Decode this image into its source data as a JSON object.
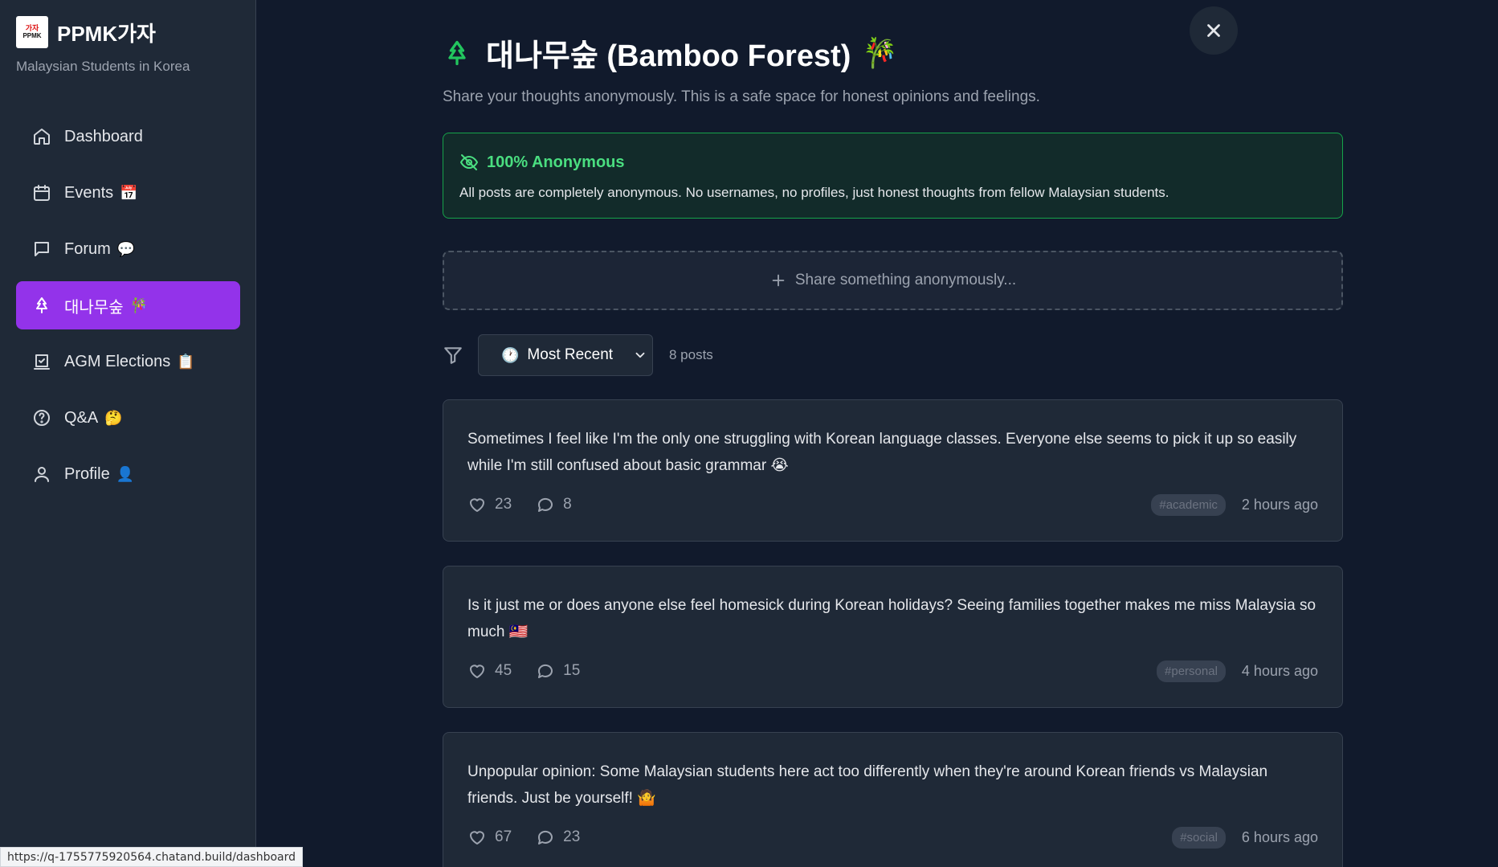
{
  "brand": {
    "name": "PPMK가자",
    "subtitle": "Malaysian Students in Korea",
    "logo_top": "가자",
    "logo_bottom": "PPMK"
  },
  "nav": {
    "items": [
      {
        "label": "Dashboard",
        "emoji": "",
        "icon": "home-icon",
        "active": false
      },
      {
        "label": "Events",
        "emoji": "📅",
        "icon": "calendar-icon",
        "active": false
      },
      {
        "label": "Forum",
        "emoji": "💬",
        "icon": "message-square-icon",
        "active": false
      },
      {
        "label": "대나무숲",
        "emoji": "🎋",
        "icon": "tree-icon",
        "active": true
      },
      {
        "label": "AGM Elections",
        "emoji": "📋",
        "icon": "vote-icon",
        "active": false
      },
      {
        "label": "Q&A",
        "emoji": "🤔",
        "icon": "help-circle-icon",
        "active": false
      },
      {
        "label": "Profile",
        "emoji": "👤",
        "icon": "user-icon",
        "active": false
      }
    ]
  },
  "page": {
    "title": "대나무숲 (Bamboo Forest)",
    "title_emoji": "🎋",
    "subtitle": "Share your thoughts anonymously. This is a safe space for honest opinions and feelings."
  },
  "anonymous_notice": {
    "title": "100% Anonymous",
    "text": "All posts are completely anonymous. No usernames, no profiles, just honest thoughts from fellow Malaysian students."
  },
  "share": {
    "label": "Share something anonymously..."
  },
  "filter": {
    "sort_icon": "🕐",
    "sort_label": "Most Recent",
    "post_count": "8 posts"
  },
  "posts": [
    {
      "text": "Sometimes I feel like I'm the only one struggling with Korean language classes. Everyone else seems to pick it up so easily while I'm still confused about basic grammar 😭",
      "likes": "23",
      "comments": "8",
      "tag": "#academic",
      "time": "2 hours ago"
    },
    {
      "text": "Is it just me or does anyone else feel homesick during Korean holidays? Seeing families together makes me miss Malaysia so much 🇲🇾",
      "likes": "45",
      "comments": "15",
      "tag": "#personal",
      "time": "4 hours ago"
    },
    {
      "text": "Unpopular opinion: Some Malaysian students here act too differently when they're around Korean friends vs Malaysian friends. Just be yourself! 🤷",
      "likes": "67",
      "comments": "23",
      "tag": "#social",
      "time": "6 hours ago"
    }
  ],
  "status_bar": {
    "url": "https://q-1755775920564.chatand.build/dashboard"
  },
  "colors": {
    "accent": "#9333ea",
    "success": "#22c55e",
    "background": "#111a2c",
    "sidebar": "#1f2937"
  }
}
